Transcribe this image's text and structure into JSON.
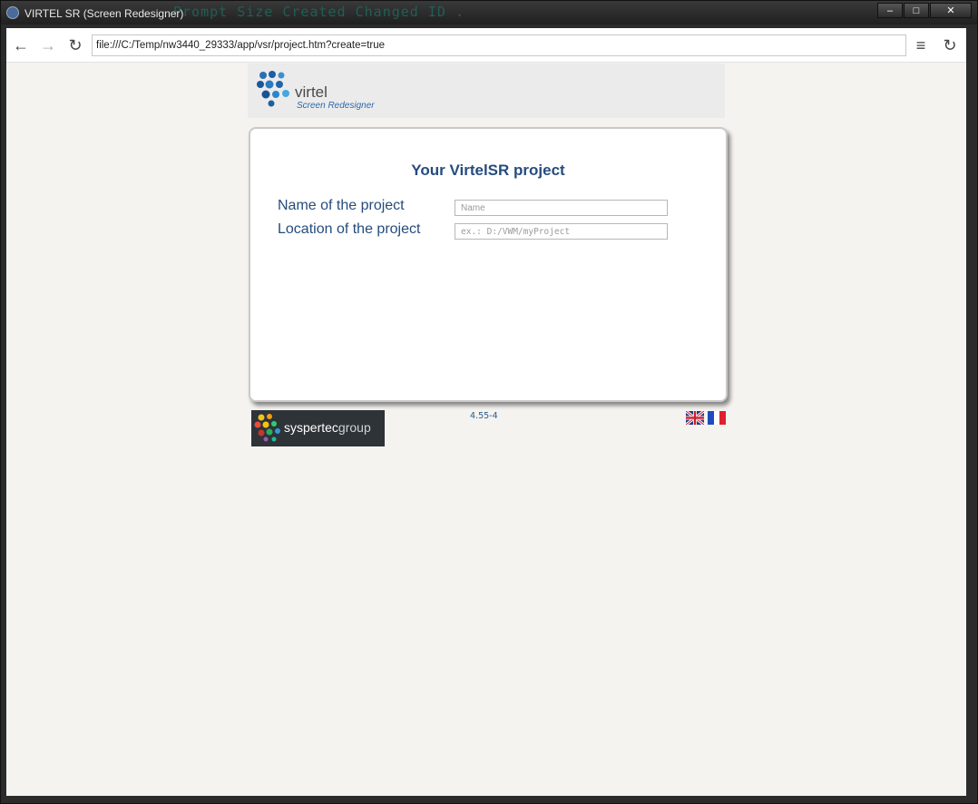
{
  "window": {
    "title": "VIRTEL SR (Screen Redesigner)",
    "background_text": "Prompt    Size   Created       Changed      ID   .",
    "controls": {
      "minimize": "–",
      "maximize": "□",
      "close": "✕"
    }
  },
  "browser": {
    "url": "file:///C:/Temp/nw3440_29333/app/vsr/project.htm?create=true",
    "icons": {
      "back": "←",
      "forward": "→",
      "reload": "↻",
      "menu": "≡"
    }
  },
  "header": {
    "logo_word": "virtel",
    "logo_subtitle": "Screen Redesigner"
  },
  "form": {
    "title": "Your VirtelSR project",
    "name_label": "Name of the project",
    "name_placeholder": "Name",
    "name_value": "",
    "location_label": "Location of the project",
    "location_placeholder": "ex.: D:/VWM/myProject",
    "location_value": ""
  },
  "footer": {
    "brand_bold": "syspertec",
    "brand_light": "group",
    "version": "4.55-4",
    "languages": [
      "English",
      "Français"
    ]
  },
  "colors": {
    "accent": "#264c7d",
    "page_bg": "#f4f3f0",
    "header_band": "#ebebeb"
  }
}
